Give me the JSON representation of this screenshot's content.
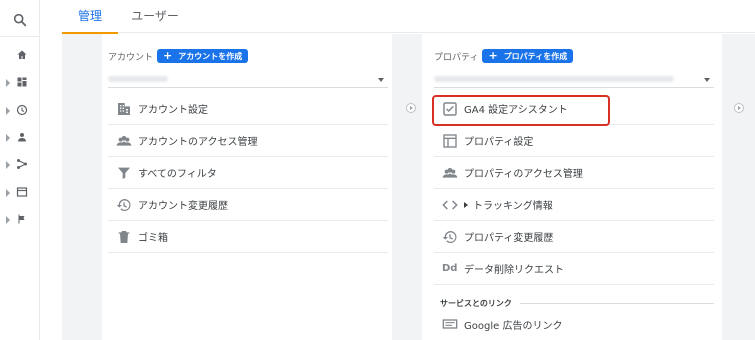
{
  "tabs": {
    "admin": "管理",
    "user": "ユーザー"
  },
  "account": {
    "label": "アカウント",
    "create_button": "アカウントを作成",
    "items": [
      {
        "label": "アカウント設定",
        "icon": "building-icon"
      },
      {
        "label": "アカウントのアクセス管理",
        "icon": "people-icon"
      },
      {
        "label": "すべてのフィルタ",
        "icon": "filter-icon"
      },
      {
        "label": "アカウント変更履歴",
        "icon": "history-icon"
      },
      {
        "label": "ゴミ箱",
        "icon": "trash-icon"
      }
    ]
  },
  "property": {
    "label": "プロパティ",
    "create_button": "プロパティを作成",
    "items": [
      {
        "label": "GA4 設定アシスタント",
        "icon": "checkbox-icon"
      },
      {
        "label": "プロパティ設定",
        "icon": "layout-icon"
      },
      {
        "label": "プロパティのアクセス管理",
        "icon": "people-icon"
      },
      {
        "label": "トラッキング情報",
        "icon": "code-icon"
      },
      {
        "label": "プロパティ変更履歴",
        "icon": "history-icon"
      },
      {
        "label": "データ削除リクエスト",
        "icon": "dd-icon"
      }
    ],
    "section_title": "サービスとのリンク",
    "link_items": [
      {
        "label": "Google 広告のリンク",
        "icon": "ads-link-icon"
      }
    ],
    "dd_text": "Dd"
  },
  "colors": {
    "accent": "#1a73e8",
    "tab_underline": "#f29900",
    "highlight": "#d93025"
  }
}
